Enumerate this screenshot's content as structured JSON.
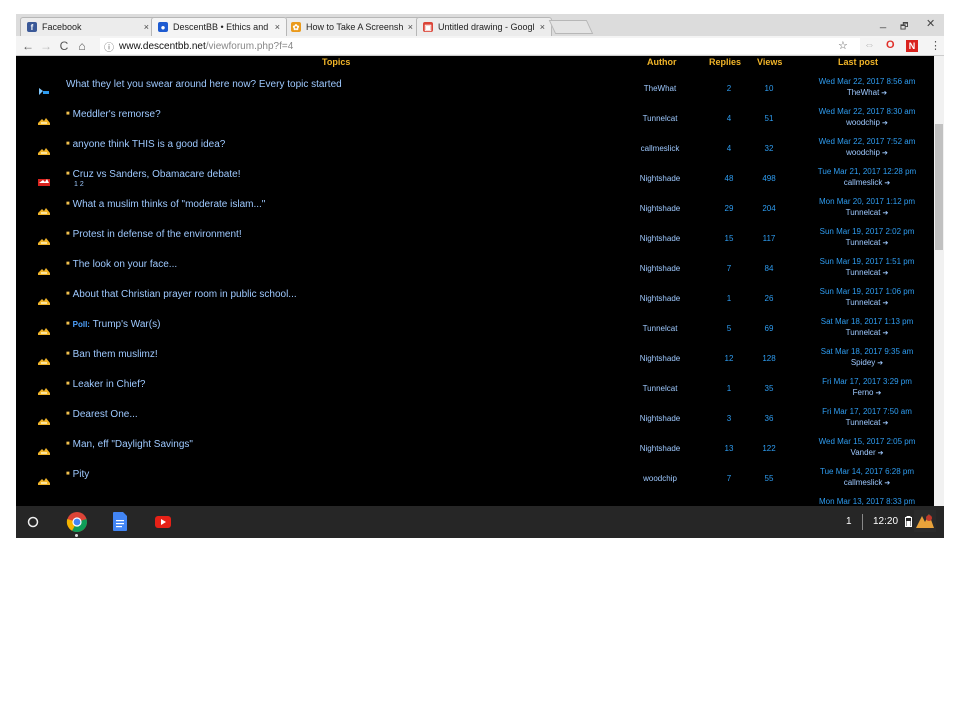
{
  "browser": {
    "tabs": [
      {
        "label": "Facebook",
        "fav_bg": "#3b5998",
        "fav_glyph": "f"
      },
      {
        "label": "DescentBB • Ethics and",
        "fav_bg": "#1e5bd1",
        "fav_glyph": "●"
      },
      {
        "label": "How to Take A Screensh",
        "fav_bg": "#ea9a1c",
        "fav_glyph": "✿"
      },
      {
        "label": "Untitled drawing - Googl",
        "fav_bg": "#db4437",
        "fav_glyph": "▣"
      }
    ],
    "tab_close": "×",
    "window_controls": {
      "minimize": "_",
      "maximize": "🗗",
      "close": "✕"
    },
    "nav": {
      "back": "←",
      "forward": "→",
      "reload": "C",
      "home": "⌂"
    },
    "url_info_icon": "ⓘ",
    "url_host": "www.descentbb.net",
    "url_path": "/viewforum.php?f=4",
    "extensions": {
      "star": "☆",
      "ext1": "⇔",
      "ext2": "O",
      "ext3": "N",
      "menu": "⋮"
    }
  },
  "forum": {
    "headers": {
      "topics": "Topics",
      "author": "Author",
      "replies": "Replies",
      "views": "Views",
      "last_post": "Last post"
    },
    "goto_icon": "➔",
    "topics": [
      {
        "title": "What they let you swear around here now? Every topic started",
        "prefix": "",
        "pages": "",
        "author": "TheWhat",
        "replies": "2",
        "views": "10",
        "last_date": "Wed Mar 22, 2017 8:56 am",
        "last_user": "TheWhat",
        "icon": "announce",
        "bullet": false
      },
      {
        "title": "Meddler's remorse?",
        "prefix": "",
        "pages": "",
        "author": "Tunnelcat",
        "replies": "4",
        "views": "51",
        "last_date": "Wed Mar 22, 2017 8:30 am",
        "last_user": "woodchip",
        "icon": "normal",
        "bullet": true
      },
      {
        "title": "anyone think THIS is a good idea?",
        "prefix": "",
        "pages": "",
        "author": "callmeslick",
        "replies": "4",
        "views": "32",
        "last_date": "Wed Mar 22, 2017 7:52 am",
        "last_user": "woodchip",
        "icon": "normal",
        "bullet": true
      },
      {
        "title": "Cruz vs Sanders, Obamacare debate!",
        "prefix": "",
        "pages": "1 2",
        "author": "Nightshade",
        "replies": "48",
        "views": "498",
        "last_date": "Tue Mar 21, 2017 12:28 pm",
        "last_user": "callmeslick",
        "icon": "hot",
        "bullet": true
      },
      {
        "title": "What a muslim thinks of \"moderate islam...\"",
        "prefix": "",
        "pages": "",
        "author": "Nightshade",
        "replies": "29",
        "views": "204",
        "last_date": "Mon Mar 20, 2017 1:12 pm",
        "last_user": "Tunnelcat",
        "icon": "normal",
        "bullet": true
      },
      {
        "title": "Protest in defense of the environment!",
        "prefix": "",
        "pages": "",
        "author": "Nightshade",
        "replies": "15",
        "views": "117",
        "last_date": "Sun Mar 19, 2017 2:02 pm",
        "last_user": "Tunnelcat",
        "icon": "normal",
        "bullet": true
      },
      {
        "title": "The look on your face...",
        "prefix": "",
        "pages": "",
        "author": "Nightshade",
        "replies": "7",
        "views": "84",
        "last_date": "Sun Mar 19, 2017 1:51 pm",
        "last_user": "Tunnelcat",
        "icon": "normal",
        "bullet": true
      },
      {
        "title": "About that Christian prayer room in public school...",
        "prefix": "",
        "pages": "",
        "author": "Nightshade",
        "replies": "1",
        "views": "26",
        "last_date": "Sun Mar 19, 2017 1:06 pm",
        "last_user": "Tunnelcat",
        "icon": "normal",
        "bullet": true
      },
      {
        "title": " Trump's War(s)",
        "prefix": "Poll:",
        "pages": "",
        "author": "Tunnelcat",
        "replies": "5",
        "views": "69",
        "last_date": "Sat Mar 18, 2017 1:13 pm",
        "last_user": "Tunnelcat",
        "icon": "normal",
        "bullet": true
      },
      {
        "title": "Ban them muslimz!",
        "prefix": "",
        "pages": "",
        "author": "Nightshade",
        "replies": "12",
        "views": "128",
        "last_date": "Sat Mar 18, 2017 9:35 am",
        "last_user": "Spidey",
        "icon": "normal",
        "bullet": true
      },
      {
        "title": "Leaker in Chief?",
        "prefix": "",
        "pages": "",
        "author": "Tunnelcat",
        "replies": "1",
        "views": "35",
        "last_date": "Fri Mar 17, 2017 3:29 pm",
        "last_user": "Ferno",
        "icon": "normal",
        "bullet": true
      },
      {
        "title": "Dearest One...",
        "prefix": "",
        "pages": "",
        "author": "Nightshade",
        "replies": "3",
        "views": "36",
        "last_date": "Fri Mar 17, 2017 7:50 am",
        "last_user": "Tunnelcat",
        "icon": "normal",
        "bullet": true
      },
      {
        "title": "Man, eff \"Daylight Savings\"",
        "prefix": "",
        "pages": "",
        "author": "Nightshade",
        "replies": "13",
        "views": "122",
        "last_date": "Wed Mar 15, 2017 2:05 pm",
        "last_user": "Vander",
        "icon": "normal",
        "bullet": true
      },
      {
        "title": "Pity",
        "prefix": "",
        "pages": "",
        "author": "woodchip",
        "replies": "7",
        "views": "55",
        "last_date": "Tue Mar 14, 2017 6:28 pm",
        "last_user": "callmeslick",
        "icon": "normal",
        "bullet": true
      },
      {
        "title": "",
        "prefix": "",
        "pages": "",
        "author": "",
        "replies": "",
        "views": "",
        "last_date": "Mon Mar 13, 2017 8:33 pm",
        "last_user": "",
        "icon": "normal",
        "bullet": false
      }
    ]
  },
  "shelf": {
    "launcher_icon": "circle-icon",
    "apps": [
      "chrome-icon",
      "docs-icon",
      "youtube-icon"
    ],
    "notification_count": "1",
    "time": "12:20",
    "battery_icon": "battery-icon"
  },
  "colors": {
    "header": "#f0b429",
    "link": "#9ec9ff",
    "number": "#2e9cf0",
    "background": "#000000"
  }
}
